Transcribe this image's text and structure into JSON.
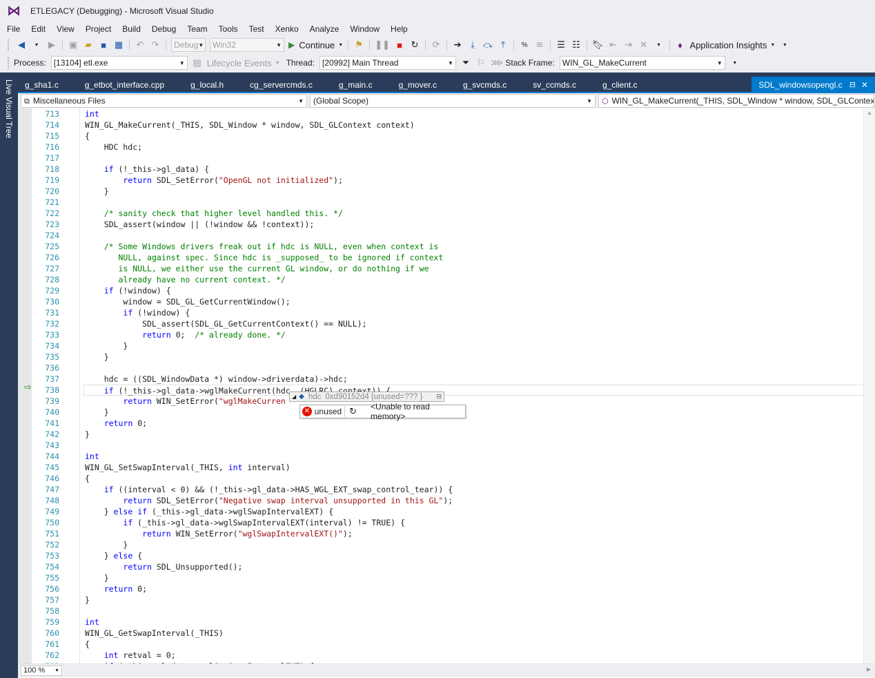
{
  "window": {
    "title": "ETLEGACY (Debugging) - Microsoft Visual Studio"
  },
  "menu": [
    "File",
    "Edit",
    "View",
    "Project",
    "Build",
    "Debug",
    "Team",
    "Tools",
    "Test",
    "Xenko",
    "Analyze",
    "Window",
    "Help"
  ],
  "toolbar": {
    "config": "Debug",
    "platform": "Win32",
    "continue_label": "Continue",
    "app_insights_label": "Application Insights",
    "process_label": "Process:",
    "process_value": "[13104] etl.exe",
    "lifecycle_label": "Lifecycle Events",
    "thread_label": "Thread:",
    "thread_value": "[20992] Main Thread",
    "stack_frame_label": "Stack Frame:",
    "stack_frame_value": "WIN_GL_MakeCurrent"
  },
  "left_strip": {
    "label": "Live Visual Tree"
  },
  "tabs": [
    "g_sha1.c",
    "g_etbot_interface.cpp",
    "g_local.h",
    "cg_servercmds.c",
    "g_main.c",
    "g_mover.c",
    "g_svcmds.c",
    "sv_ccmds.c",
    "g_client.c"
  ],
  "active_tab": "SDL_windowsopengl.c",
  "nav": {
    "project": "Miscellaneous Files",
    "scope": "(Global Scope)",
    "member": "WIN_GL_MakeCurrent(_THIS, SDL_Window * window, SDL_GLContext cc"
  },
  "line_start": 713,
  "code_lines": [
    [
      [
        "kw",
        "int"
      ]
    ],
    [
      [
        "",
        "WIN_GL_MakeCurrent(_THIS, SDL_Window * window, SDL_GLContext context)"
      ]
    ],
    [
      [
        "",
        "{"
      ]
    ],
    [
      [
        "",
        "    HDC hdc;"
      ]
    ],
    [],
    [
      [
        "",
        "    "
      ],
      [
        "kw",
        "if"
      ],
      [
        "",
        " (!_this->gl_data) {"
      ]
    ],
    [
      [
        "",
        "        "
      ],
      [
        "kw",
        "return"
      ],
      [
        "",
        " SDL_SetError("
      ],
      [
        "str",
        "\"OpenGL not initialized\""
      ],
      [
        "",
        ");"
      ]
    ],
    [
      [
        "",
        "    }"
      ]
    ],
    [],
    [
      [
        "",
        "    "
      ],
      [
        "cm",
        "/* sanity check that higher level handled this. */"
      ]
    ],
    [
      [
        "",
        "    SDL_assert(window || (!window && !context));"
      ]
    ],
    [],
    [
      [
        "",
        "    "
      ],
      [
        "cm",
        "/* Some Windows drivers freak out if hdc is NULL, even when context is"
      ]
    ],
    [
      [
        "cm",
        "       NULL, against spec. Since hdc is _supposed_ to be ignored if context"
      ]
    ],
    [
      [
        "cm",
        "       is NULL, we either use the current GL window, or do nothing if we"
      ]
    ],
    [
      [
        "cm",
        "       already have no current context. */"
      ]
    ],
    [
      [
        "",
        "    "
      ],
      [
        "kw",
        "if"
      ],
      [
        "",
        " (!window) {"
      ]
    ],
    [
      [
        "",
        "        window = SDL_GL_GetCurrentWindow();"
      ]
    ],
    [
      [
        "",
        "        "
      ],
      [
        "kw",
        "if"
      ],
      [
        "",
        " (!window) {"
      ]
    ],
    [
      [
        "",
        "            SDL_assert(SDL_GL_GetCurrentContext() == NULL);"
      ]
    ],
    [
      [
        "",
        "            "
      ],
      [
        "kw",
        "return"
      ],
      [
        "",
        " 0;  "
      ],
      [
        "cm",
        "/* already done. */"
      ]
    ],
    [
      [
        "",
        "        }"
      ]
    ],
    [
      [
        "",
        "    }"
      ]
    ],
    [],
    [
      [
        "",
        "    hdc = ((SDL_WindowData *) window->driverdata)->hdc;"
      ]
    ],
    [
      [
        "",
        "    "
      ],
      [
        "kw",
        "if"
      ],
      [
        "",
        " (!_this->gl_data->wglMakeCurrent(hdc, (HGLRC) context)) {"
      ]
    ],
    [
      [
        "",
        "        "
      ],
      [
        "kw",
        "return"
      ],
      [
        "",
        " WIN_SetError("
      ],
      [
        "str",
        "\"wglMakeCurren"
      ]
    ],
    [
      [
        "",
        "    }"
      ]
    ],
    [
      [
        "",
        "    "
      ],
      [
        "kw",
        "return"
      ],
      [
        "",
        " 0;"
      ]
    ],
    [
      [
        "",
        "}"
      ]
    ],
    [],
    [
      [
        "kw",
        "int"
      ]
    ],
    [
      [
        "",
        "WIN_GL_SetSwapInterval(_THIS, "
      ],
      [
        "kw",
        "int"
      ],
      [
        "",
        " interval)"
      ]
    ],
    [
      [
        "",
        "{"
      ]
    ],
    [
      [
        "",
        "    "
      ],
      [
        "kw",
        "if"
      ],
      [
        "",
        " ((interval < 0) && (!_this->gl_data->HAS_WGL_EXT_swap_control_tear)) {"
      ]
    ],
    [
      [
        "",
        "        "
      ],
      [
        "kw",
        "return"
      ],
      [
        "",
        " SDL_SetError("
      ],
      [
        "str",
        "\"Negative swap interval unsupported in this GL\""
      ],
      [
        "",
        ");"
      ]
    ],
    [
      [
        "",
        "    } "
      ],
      [
        "kw",
        "else"
      ],
      [
        "",
        " "
      ],
      [
        "kw",
        "if"
      ],
      [
        "",
        " (_this->gl_data->wglSwapIntervalEXT) {"
      ]
    ],
    [
      [
        "",
        "        "
      ],
      [
        "kw",
        "if"
      ],
      [
        "",
        " (_this->gl_data->wglSwapIntervalEXT(interval) != TRUE) {"
      ]
    ],
    [
      [
        "",
        "            "
      ],
      [
        "kw",
        "return"
      ],
      [
        "",
        " WIN_SetError("
      ],
      [
        "str",
        "\"wglSwapIntervalEXT()\""
      ],
      [
        "",
        ");"
      ]
    ],
    [
      [
        "",
        "        }"
      ]
    ],
    [
      [
        "",
        "    } "
      ],
      [
        "kw",
        "else"
      ],
      [
        "",
        " {"
      ]
    ],
    [
      [
        "",
        "        "
      ],
      [
        "kw",
        "return"
      ],
      [
        "",
        " SDL_Unsupported();"
      ]
    ],
    [
      [
        "",
        "    }"
      ]
    ],
    [
      [
        "",
        "    "
      ],
      [
        "kw",
        "return"
      ],
      [
        "",
        " 0;"
      ]
    ],
    [
      [
        "",
        "}"
      ]
    ],
    [],
    [
      [
        "kw",
        "int"
      ]
    ],
    [
      [
        "",
        "WIN_GL_GetSwapInterval(_THIS)"
      ]
    ],
    [
      [
        "",
        "{"
      ]
    ],
    [
      [
        "",
        "    "
      ],
      [
        "kw",
        "int"
      ],
      [
        "",
        " retval = 0;"
      ]
    ],
    [
      [
        "",
        "    "
      ],
      [
        "kw",
        "if"
      ],
      [
        "",
        " (_this->gl_data->wglGetSwapIntervalEXT) {"
      ]
    ]
  ],
  "current_line": 738,
  "datatip": {
    "name": "hdc",
    "value": "0xd90152d4 {unused=??? }",
    "child_name": "unused",
    "child_value": "<Unable to read memory>"
  },
  "zoom": "100 %",
  "colors": {
    "accent": "#007acc",
    "keyword": "#0000ff",
    "string": "#a31515",
    "comment": "#008000",
    "line_number": "#2b91af",
    "doc_well": "#2b3c5a"
  }
}
